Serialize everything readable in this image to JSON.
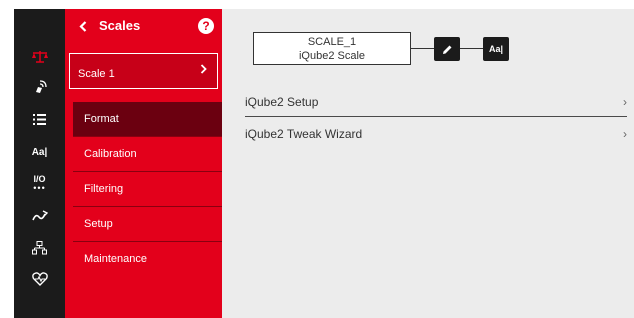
{
  "rail": {
    "icons": [
      "scale-icon",
      "hand-signal-icon",
      "list-icon",
      "font-format-icon",
      "io-icon",
      "route-icon",
      "network-icon",
      "heart-health-icon"
    ],
    "font_label": "Aa|",
    "io_label": "I/O",
    "active_color": "#e3001b"
  },
  "panel": {
    "title": "Scales",
    "help": "?",
    "scale_item": "Scale 1",
    "menu": [
      {
        "label": "Format",
        "active": true
      },
      {
        "label": "Calibration",
        "active": false
      },
      {
        "label": "Filtering",
        "active": false
      },
      {
        "label": "Setup",
        "active": false
      },
      {
        "label": "Maintenance",
        "active": false
      }
    ]
  },
  "main": {
    "scale_box": {
      "name": "SCALE_1",
      "type": "iQube2 Scale"
    },
    "format_btn": "Aa|",
    "rows": [
      {
        "label": "iQube2 Setup",
        "chevron": "›"
      },
      {
        "label": "iQube2 Tweak Wizard",
        "chevron": "›"
      }
    ]
  },
  "colors": {
    "brand_red": "#e3001b",
    "active_item": "#6b0010",
    "rail_bg": "#1b1b1b",
    "content_bg": "#ececec"
  }
}
